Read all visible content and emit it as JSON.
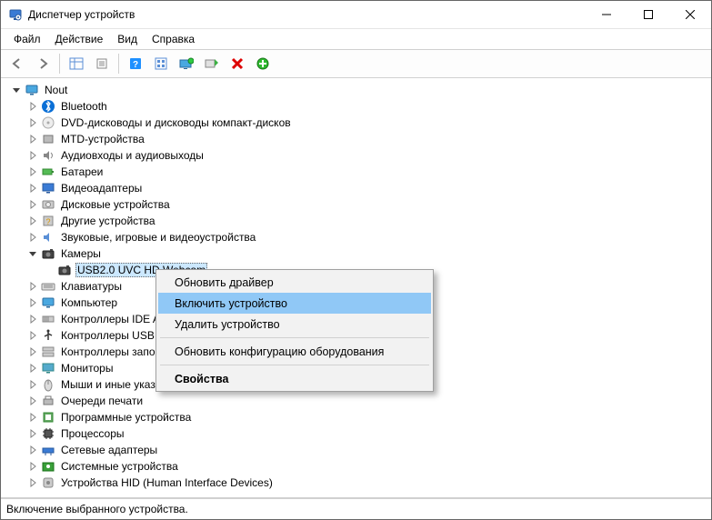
{
  "window": {
    "title": "Диспетчер устройств"
  },
  "menu": [
    "Файл",
    "Действие",
    "Вид",
    "Справка"
  ],
  "tree": {
    "root": "Nout",
    "nodes": [
      {
        "label": "Bluetooth",
        "icon": "bluetooth",
        "expandable": true
      },
      {
        "label": "DVD-дисководы и дисководы компакт-дисков",
        "icon": "disc",
        "expandable": true
      },
      {
        "label": "MTD-устройства",
        "icon": "generic",
        "expandable": true
      },
      {
        "label": "Аудиовходы и аудиовыходы",
        "icon": "audio",
        "expandable": true
      },
      {
        "label": "Батареи",
        "icon": "battery",
        "expandable": true
      },
      {
        "label": "Видеоадаптеры",
        "icon": "display",
        "expandable": true
      },
      {
        "label": "Дисковые устройства",
        "icon": "disk",
        "expandable": true
      },
      {
        "label": "Другие устройства",
        "icon": "other",
        "expandable": true
      },
      {
        "label": "Звуковые, игровые и видеоустройства",
        "icon": "sound",
        "expandable": true
      },
      {
        "label": "Камеры",
        "icon": "camera",
        "expandable": true,
        "expanded": true,
        "children": [
          {
            "label": "USB2.0 UVC HD Webcam",
            "icon": "camera",
            "selected": true
          }
        ]
      },
      {
        "label": "Клавиатуры",
        "icon": "keyboard",
        "expandable": true
      },
      {
        "label": "Компьютер",
        "icon": "computer",
        "expandable": true
      },
      {
        "label": "Контроллеры IDE ATA/ATAPI",
        "icon": "ide",
        "expandable": true
      },
      {
        "label": "Контроллеры USB",
        "icon": "usb",
        "expandable": true
      },
      {
        "label": "Контроллеры запоминающих устройств",
        "icon": "storage",
        "expandable": true
      },
      {
        "label": "Мониторы",
        "icon": "monitor",
        "expandable": true
      },
      {
        "label": "Мыши и иные указывающие устройства",
        "icon": "mouse",
        "expandable": true
      },
      {
        "label": "Очереди печати",
        "icon": "printer",
        "expandable": true
      },
      {
        "label": "Программные устройства",
        "icon": "software",
        "expandable": true
      },
      {
        "label": "Процессоры",
        "icon": "cpu",
        "expandable": true
      },
      {
        "label": "Сетевые адаптеры",
        "icon": "network",
        "expandable": true
      },
      {
        "label": "Системные устройства",
        "icon": "system",
        "expandable": true
      },
      {
        "label": "Устройства HID (Human Interface Devices)",
        "icon": "hid",
        "expandable": true
      }
    ]
  },
  "context_menu": {
    "items": [
      {
        "label": "Обновить драйвер",
        "type": "item"
      },
      {
        "label": "Включить устройство",
        "type": "item",
        "highlight": true
      },
      {
        "label": "Удалить устройство",
        "type": "item"
      },
      {
        "type": "sep"
      },
      {
        "label": "Обновить конфигурацию оборудования",
        "type": "item"
      },
      {
        "type": "sep"
      },
      {
        "label": "Свойства",
        "type": "item",
        "bold": true
      }
    ]
  },
  "statusbar": "Включение выбранного устройства."
}
